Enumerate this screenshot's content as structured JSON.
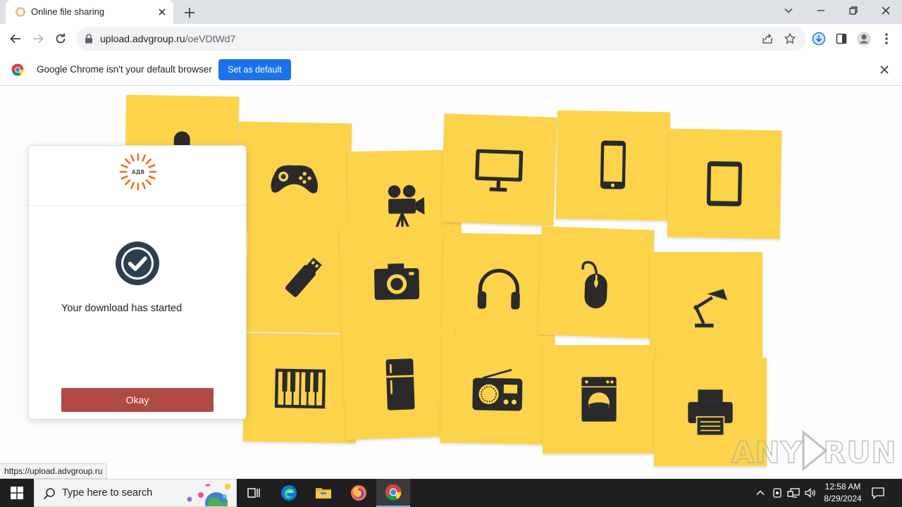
{
  "browser": {
    "tab": {
      "title": "Online file sharing",
      "favicon": "adv-logo-icon"
    },
    "address_bar": {
      "domain": "upload.advgroup.ru",
      "path": "/oeVDtWd7"
    },
    "infobar": {
      "message": "Google Chrome isn't your default browser",
      "button_label": "Set as default"
    },
    "status_url": "https://upload.advgroup.ru",
    "accent_color": "#1a73e8"
  },
  "page": {
    "modal": {
      "logo_text": "АДВ",
      "message": "Your download has started",
      "button_label": "Okay",
      "button_color": "#b04a45",
      "logo_color": "#f26b21"
    },
    "background_notes": [
      "microphone-icon",
      "gamepad-icon",
      "movie-camera-icon",
      "monitor-icon",
      "smartphone-icon",
      "tablet-icon",
      "usb-drive-icon",
      "camera-icon",
      "headphones-icon",
      "mouse-icon",
      "desk-lamp-icon",
      "piano-icon",
      "refrigerator-icon",
      "radio-icon",
      "washing-machine-icon",
      "printer-icon"
    ],
    "note_color": "#fcd34a",
    "watermark": "ANY RUN"
  },
  "taskbar": {
    "search_placeholder": "Type here to search",
    "apps": [
      "task-view-icon",
      "edge-icon",
      "file-explorer-icon",
      "firefox-icon",
      "chrome-icon"
    ],
    "clock": {
      "time": "12:58 AM",
      "date": "8/29/2024"
    }
  }
}
